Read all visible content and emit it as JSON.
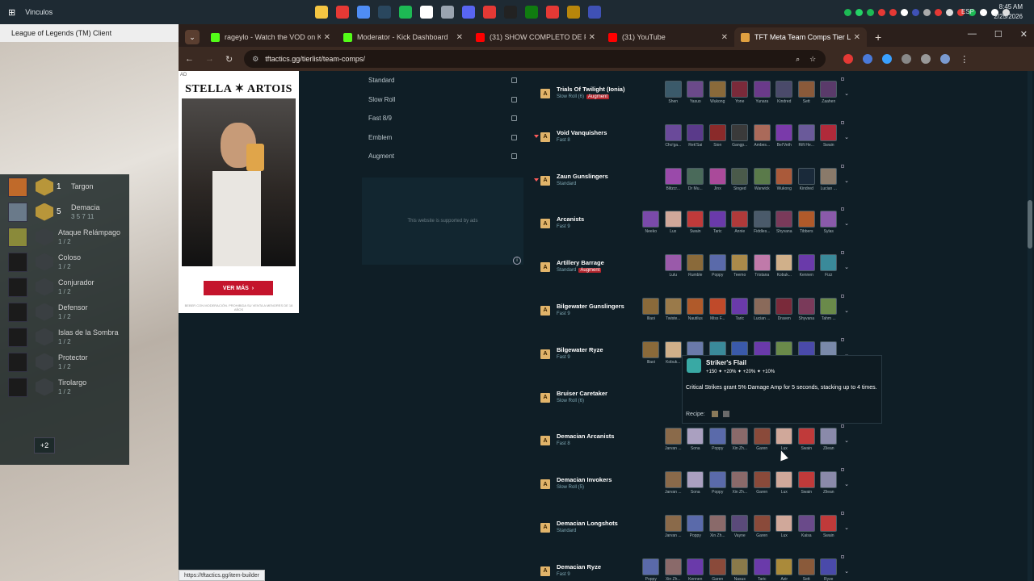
{
  "taskbar": {
    "folder_label": "Vinculos",
    "language": "ESP",
    "time": "8:45 AM",
    "date": "2/25/2026",
    "pinned_colors": [
      "#f4c542",
      "#e53935",
      "#4f8df5",
      "#2a475e",
      "#1db954",
      "#ffffff",
      "#9aa4b0",
      "#5865f2",
      "#e53935",
      "#222222",
      "#107c10",
      "#e53935",
      "#b8860b",
      "#3f51b5"
    ]
  },
  "lol_client": {
    "title": "League of Legends (TM) Client",
    "traits": [
      {
        "num": "1",
        "name": "Targon",
        "count": "",
        "active": true
      },
      {
        "num": "5",
        "name": "Demacia",
        "count": "3 5 7 11",
        "active": true
      },
      {
        "num": "",
        "name": "Ataque Relámpago",
        "count": "1 / 2",
        "active": false
      },
      {
        "num": "",
        "name": "Coloso",
        "count": "1 / 2",
        "active": false
      },
      {
        "num": "",
        "name": "Conjurador",
        "count": "1 / 2",
        "active": false
      },
      {
        "num": "",
        "name": "Defensor",
        "count": "1 / 2",
        "active": false
      },
      {
        "num": "",
        "name": "Islas de la Sombra",
        "count": "1 / 2",
        "active": false
      },
      {
        "num": "",
        "name": "Protector",
        "count": "1 / 2",
        "active": false
      },
      {
        "num": "",
        "name": "Tirolargo",
        "count": "1 / 2",
        "active": false
      }
    ],
    "more_label": "+2"
  },
  "browser": {
    "tabs": [
      {
        "label": "rageylo - Watch the VOD on Ki",
        "color": "#53fc18"
      },
      {
        "label": "Moderator - Kick Dashboard",
        "color": "#53fc18"
      },
      {
        "label": "(31) SHOW COMPLETO DE FRO",
        "color": "#ff0000"
      },
      {
        "label": "(31) YouTube",
        "color": "#ff0000"
      },
      {
        "label": "TFT Meta Team Comps Tier List",
        "color": "#e0a040"
      }
    ],
    "url": "tftactics.gg/tierlist/team-comps/",
    "status_url": "https://tftactics.gg/item-builder"
  },
  "ad": {
    "tag": "AD",
    "brand": "STELLA ✶ ARTOIS",
    "cta": "VER MÁS",
    "legal": "BEBER CON MODERACIÓN. PROHIBIDA SU VENTA A MENORES DE 18 AÑOS"
  },
  "filters": [
    {
      "label": "Standard"
    },
    {
      "label": "Slow Roll"
    },
    {
      "label": "Fast 8/9"
    },
    {
      "label": "Emblem"
    },
    {
      "label": "Augment"
    }
  ],
  "ads_note": "This website is supported by ads",
  "comps": [
    {
      "name": "Trials Of Twilight (Ionia)",
      "sub": "Slow Roll (6)",
      "aug": "Augment",
      "tier": "A",
      "arrow": false,
      "units": [
        "Shen",
        "Yasuo",
        "Wukong",
        "Yone",
        "Yunara",
        "Kindred",
        "Sett",
        "Zaahen"
      ],
      "colors": [
        "#3b5a6a",
        "#6b4a8a",
        "#8a6a3a",
        "#7a2a3a",
        "#6a3a8a",
        "#4a4a6a",
        "#8a5a3a",
        "#5a3a6a"
      ]
    },
    {
      "name": "Void Vanquishers",
      "sub": "Fast 8",
      "aug": "",
      "tier": "A",
      "arrow": true,
      "units": [
        "Cho'ga...",
        "Rek'Sai",
        "Sion",
        "Gangp...",
        "Ambes...",
        "Bel'Veth",
        "Rift He...",
        "Swain"
      ],
      "colors": [
        "#6a4a9a",
        "#5a3a8a",
        "#8a2a2a",
        "#3a3a3a",
        "#aa6a5a",
        "#7a3aaa",
        "#6a5a9a",
        "#b02a3a"
      ]
    },
    {
      "name": "Zaun Gunslingers",
      "sub": "Standard",
      "aug": "",
      "tier": "A",
      "arrow": true,
      "units": [
        "Blitzcr...",
        "Dr Mu...",
        "Jinx",
        "Singed",
        "Warwick",
        "Wukong",
        "Kindred",
        "Lucian ..."
      ],
      "colors": [
        "#9a4aaa",
        "#4a6a5a",
        "#aa4a9a",
        "#4a5a4a",
        "#5a7a4a",
        "#aa5a3a",
        "#1a2a3a",
        "#8a7a6a"
      ]
    },
    {
      "name": "Arcanists",
      "sub": "Fast 9",
      "aug": "",
      "tier": "A",
      "arrow": false,
      "units": [
        "Neeko",
        "Lux",
        "Swain",
        "Taric",
        "Annie",
        "Fiddles...",
        "Shyvana",
        "Tibbers",
        "Sylas"
      ],
      "colors": [
        "#7a4aaa",
        "#d0a89a",
        "#c03a3a",
        "#6a3aaa",
        "#b03a3a",
        "#4a5a6a",
        "#7a3a5a",
        "#b05a2a",
        "#8a5aaa"
      ]
    },
    {
      "name": "Artillery Barrage",
      "sub": "Standard",
      "aug": "Augment",
      "tier": "A",
      "arrow": false,
      "units": [
        "Lulu",
        "Rumble",
        "Poppy",
        "Teemo",
        "Tristana",
        "Kobuk...",
        "Kennen",
        "Fizz"
      ],
      "colors": [
        "#9a5aaa",
        "#8a6a3a",
        "#5a6aaa",
        "#aa8a4a",
        "#c07aaa",
        "#d0b08a",
        "#6a3aaa",
        "#3a8a9a"
      ]
    },
    {
      "name": "Bilgewater Gunslingers",
      "sub": "Fast 9",
      "aug": "",
      "tier": "A",
      "arrow": false,
      "units": [
        "Illaoi",
        "Twiste...",
        "Nautilus",
        "Miss F...",
        "Taric",
        "Lucian ...",
        "Draven",
        "Shyvana",
        "Tahm ..."
      ],
      "colors": [
        "#8a6a3a",
        "#9a7a4a",
        "#b05a2a",
        "#c04a2a",
        "#6a3aaa",
        "#8a6a5a",
        "#7a2a3a",
        "#7a3a5a",
        "#6a8a4a"
      ]
    },
    {
      "name": "Bilgewater Ryze",
      "sub": "Fast 9",
      "aug": "",
      "tier": "A",
      "arrow": false,
      "units": [
        "Illaoi",
        "Kobuk...",
        "Braum",
        "Fizz",
        "Lissan...",
        "Taric",
        "Tahm ...",
        "Ryze",
        "Volibear"
      ],
      "colors": [
        "#8a6a3a",
        "#d0b08a",
        "#6a7aaa",
        "#3a8a9a",
        "#3a5aaa",
        "#6a3aaa",
        "#6a8a4a",
        "#4a4aaa",
        "#7a8aaa"
      ]
    },
    {
      "name": "Bruiser Caretaker",
      "sub": "Slow Roll (6)",
      "aug": "",
      "tier": "A",
      "arrow": false,
      "units": [
        "Illaoi"
      ],
      "colors": [
        "#8a6a3a"
      ]
    },
    {
      "name": "Demacian Arcanists",
      "sub": "Fast 8",
      "aug": "",
      "tier": "A",
      "arrow": false,
      "units": [
        "Jarvan ...",
        "Sona",
        "Poppy",
        "Xin Zh...",
        "Garen",
        "Lux",
        "Swain",
        "Zilean"
      ],
      "colors": [
        "#8a6a4a",
        "#aaa0c0",
        "#5a6aaa",
        "#8a6a6a",
        "#8a4a3a",
        "#d0a89a",
        "#c03a3a",
        "#8a8aaa"
      ]
    },
    {
      "name": "Demacian Invokers",
      "sub": "Slow Roll (5)",
      "aug": "",
      "tier": "A",
      "arrow": false,
      "units": [
        "Jarvan ...",
        "Sona",
        "Poppy",
        "Xin Zh...",
        "Garen",
        "Lux",
        "Swain",
        "Zilean"
      ],
      "colors": [
        "#8a6a4a",
        "#aaa0c0",
        "#5a6aaa",
        "#8a6a6a",
        "#8a4a3a",
        "#d0a89a",
        "#c03a3a",
        "#8a8aaa"
      ]
    },
    {
      "name": "Demacian Longshots",
      "sub": "Standard",
      "aug": "",
      "tier": "A",
      "arrow": false,
      "units": [
        "Jarvan ...",
        "Poppy",
        "Xin Zh...",
        "Vayne",
        "Garen",
        "Lux",
        "Kaisa",
        "Swain"
      ],
      "colors": [
        "#8a6a4a",
        "#5a6aaa",
        "#8a6a6a",
        "#5a4a7a",
        "#8a4a3a",
        "#d0a89a",
        "#6a4a8a",
        "#c03a3a"
      ]
    },
    {
      "name": "Demacian Ryze",
      "sub": "Fast 9",
      "aug": "",
      "tier": "A",
      "arrow": false,
      "units": [
        "Poppy",
        "Xin Zh...",
        "Kennen",
        "Garen",
        "Nasus",
        "Taric",
        "Azir",
        "Sett",
        "Ryze"
      ],
      "colors": [
        "#5a6aaa",
        "#8a6a6a",
        "#6a3aaa",
        "#8a4a3a",
        "#8a7a4a",
        "#6a3aaa",
        "#aa8a3a",
        "#8a5a3a",
        "#4a4aaa"
      ]
    }
  ],
  "tooltip": {
    "name": "Striker's Flail",
    "stats": "+150   ✦ +20%   ✦ +20%   ✦ +10%",
    "desc": "Critical Strikes grant 5% Damage Amp for 5 seconds, stacking up to 4 times.",
    "recipe_label": "Recipe:"
  }
}
